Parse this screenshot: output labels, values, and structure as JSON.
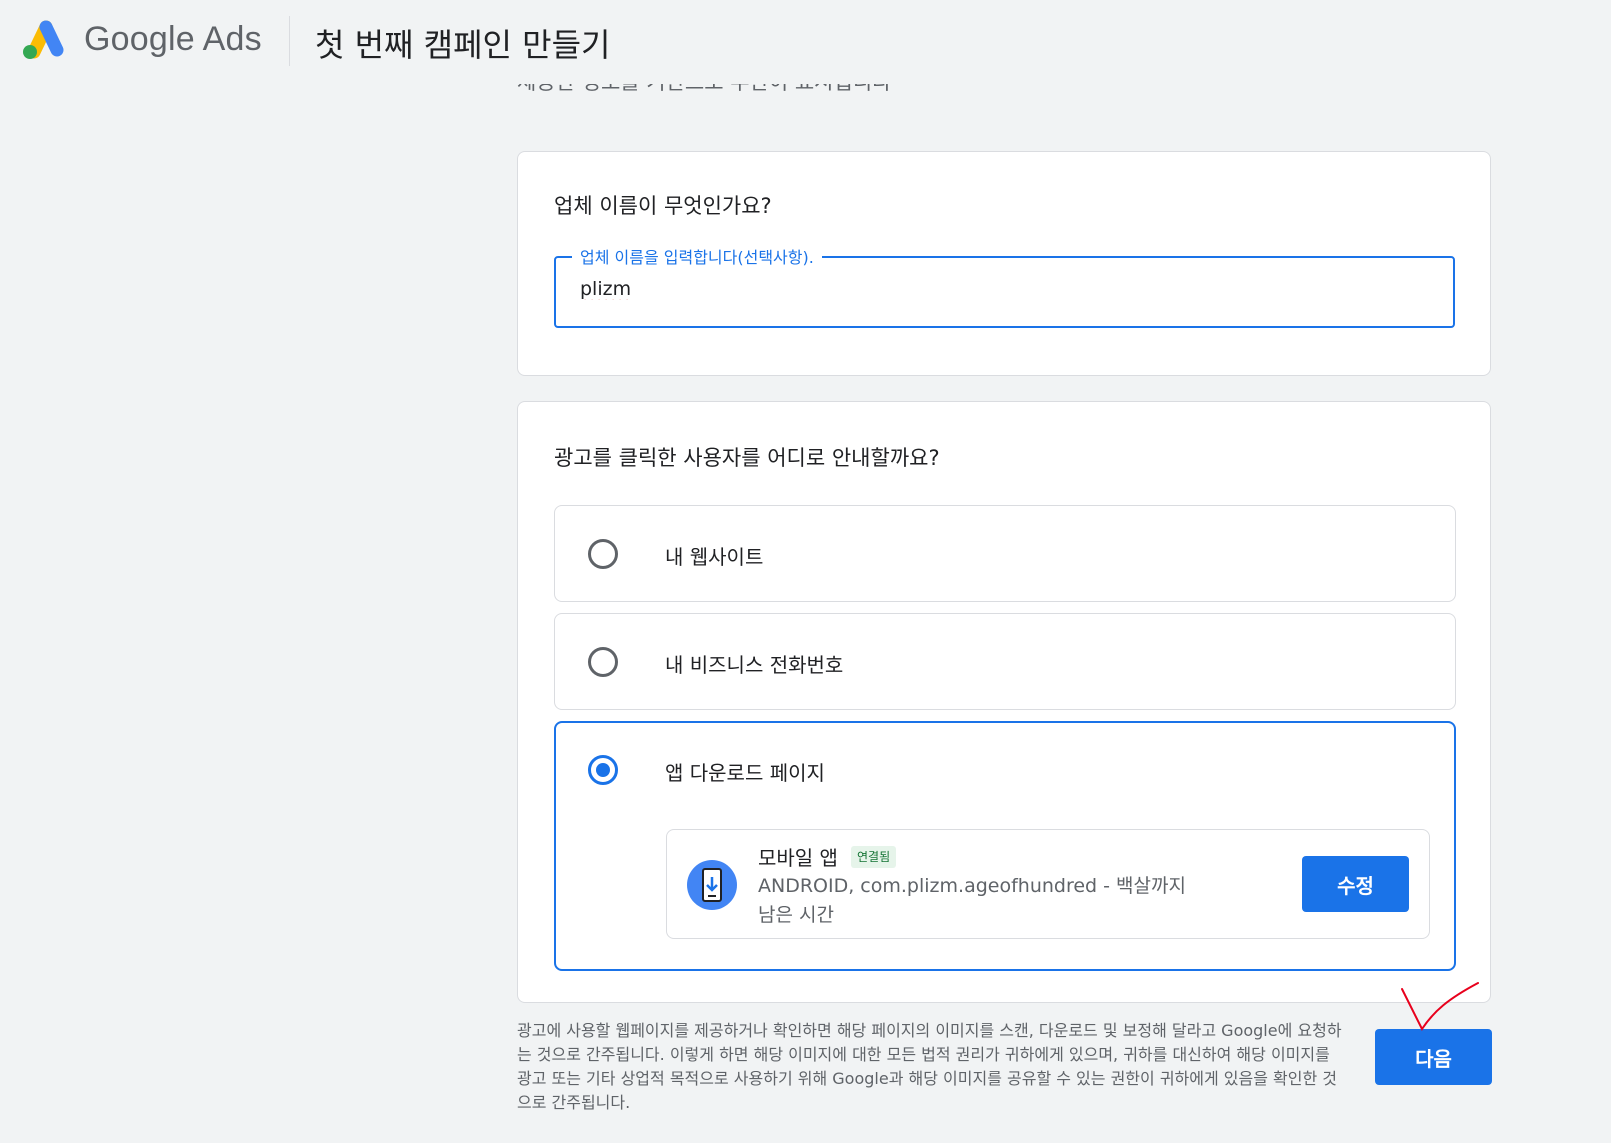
{
  "header": {
    "logo_text": "Google Ads",
    "page_title": "첫 번째 캠페인 만들기"
  },
  "partial_text": "제공한 정보를 기반으로 부관이 표시됩니다",
  "business_card": {
    "heading": "업체 이름이 무엇인가요?",
    "field_label": "업체 이름을 입력합니다(선택사항).",
    "field_value": "plizm"
  },
  "destination_card": {
    "heading": "광고를 클릭한 사용자를 어디로 안내할까요?",
    "options": [
      {
        "label": "내 웹사이트",
        "selected": false
      },
      {
        "label": "내 비즈니스 전화번호",
        "selected": false
      },
      {
        "label": "앱 다운로드 페이지",
        "selected": true
      }
    ],
    "app": {
      "title": "모바일 앱",
      "badge": "연결됨",
      "description": "ANDROID, com.plizm.ageofhundred - 백살까지 남은 시간",
      "edit_label": "수정"
    }
  },
  "footer": {
    "disclaimer": "광고에 사용할 웹페이지를 제공하거나 확인하면 해당 페이지의 이미지를 스캔, 다운로드 및 보정해 달라고 Google에 요청하는 것으로 간주됩니다. 이렇게 하면 해당 이미지에 대한 모든 법적 권리가 귀하에게 있으며, 귀하를 대신하여 해당 이미지를 광고 또는 기타 상업적 목적으로 사용하기 위해 Google과 해당 이미지를 공유할 수 있는 권한이 귀하에게 있음을 확인한 것으로 간주됩니다.",
    "next_label": "다음"
  },
  "colors": {
    "accent": "#1a73e8",
    "background": "#f1f3f4",
    "annotation": "#e8001c"
  }
}
